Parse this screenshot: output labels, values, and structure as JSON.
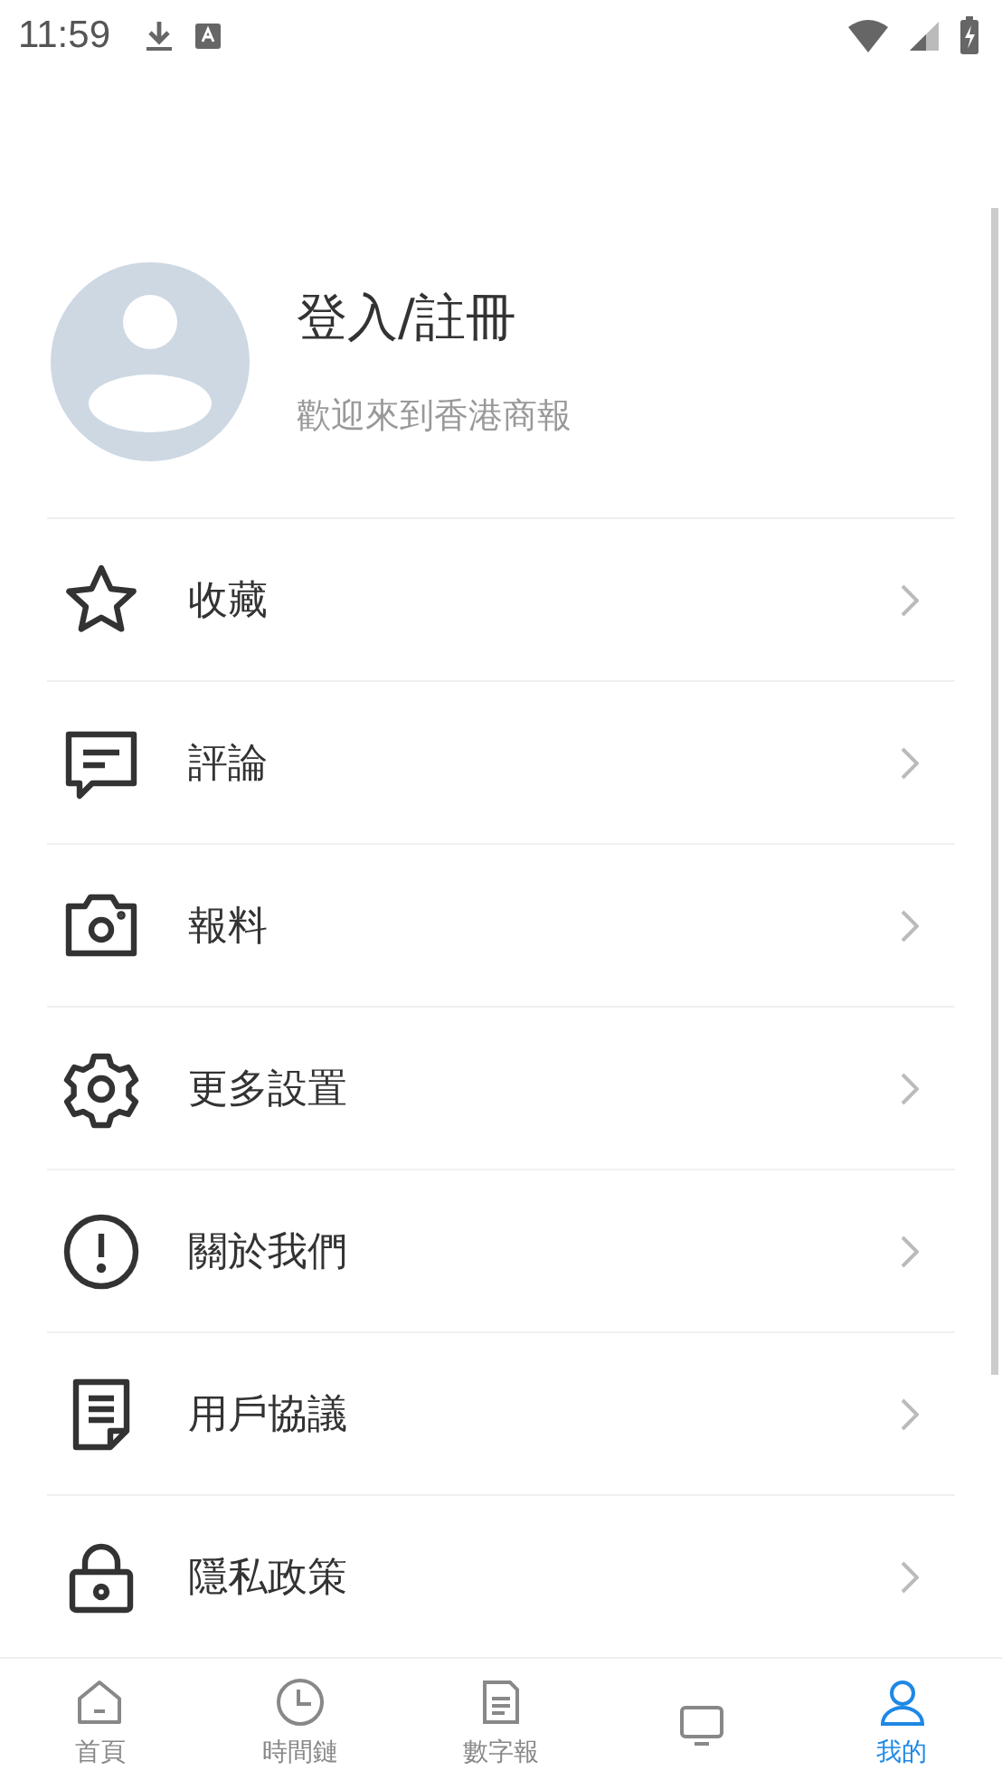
{
  "status_bar": {
    "time": "11:59"
  },
  "profile": {
    "title": "登入/註冊",
    "subtitle": "歡迎來到香港商報"
  },
  "menu": [
    {
      "kind": "star",
      "label": "收藏"
    },
    {
      "kind": "comment",
      "label": "評論"
    },
    {
      "kind": "camera",
      "label": "報料"
    },
    {
      "kind": "gear",
      "label": "更多設置"
    },
    {
      "kind": "info",
      "label": "關於我們"
    },
    {
      "kind": "document",
      "label": "用戶協議"
    },
    {
      "kind": "lock",
      "label": "隱私政策"
    }
  ],
  "bottom_nav": [
    {
      "kind": "home",
      "label": "首頁",
      "selected": false
    },
    {
      "kind": "clock",
      "label": "時間鏈",
      "selected": false
    },
    {
      "kind": "paper",
      "label": "數字報",
      "selected": false
    },
    {
      "kind": "tv",
      "selected": false
    },
    {
      "kind": "person",
      "label": "我的",
      "selected": true
    }
  ]
}
